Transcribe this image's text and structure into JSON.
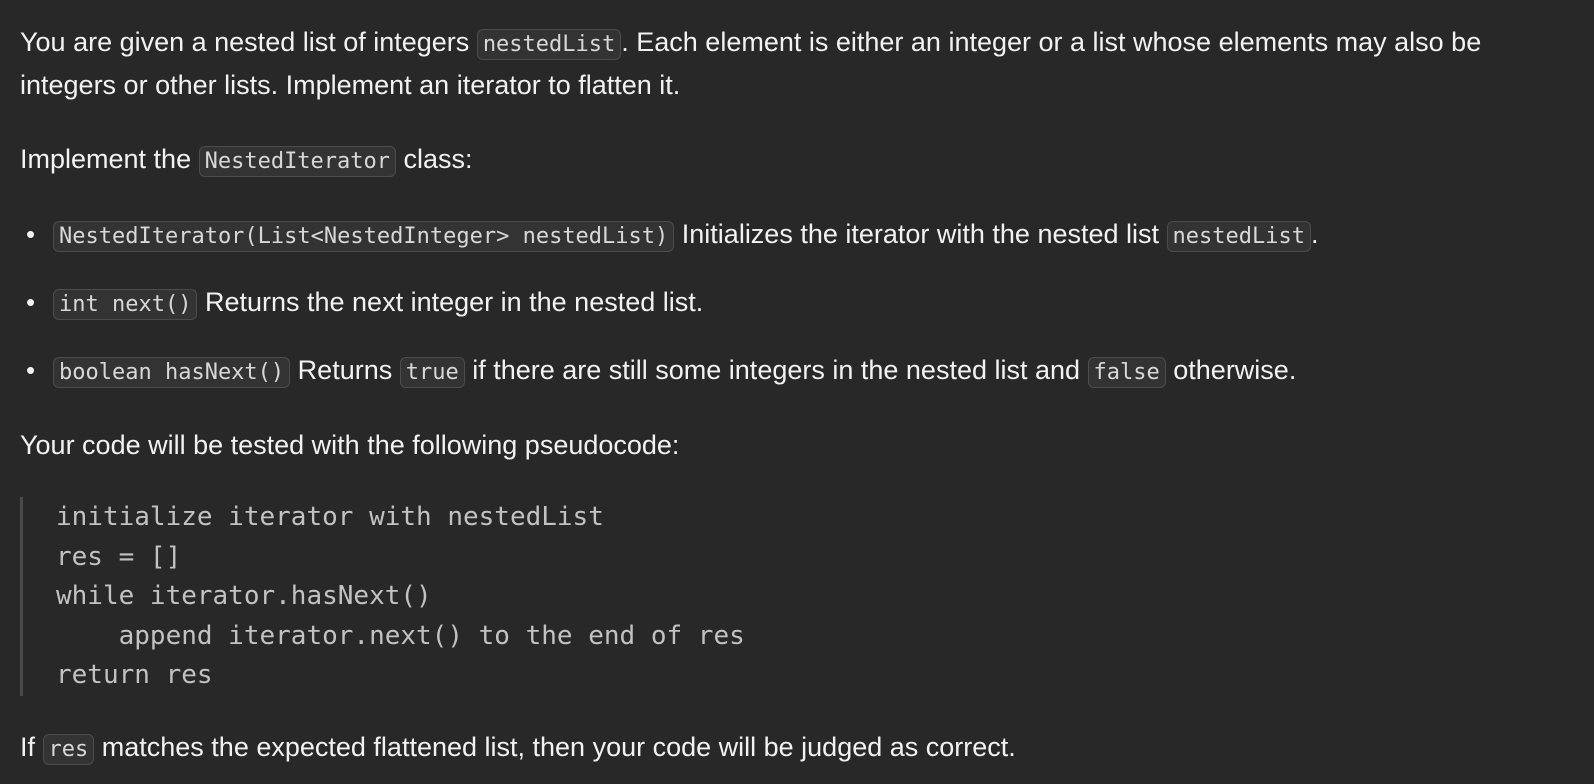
{
  "intro": {
    "part1": "You are given a nested list of integers ",
    "code1": "nestedList",
    "part2": ". Each element is either an integer or a list whose elements may also be integers or other lists. Implement an iterator to flatten it."
  },
  "implement": {
    "part1": "Implement the ",
    "code1": "NestedIterator",
    "part2": " class:"
  },
  "methods": [
    {
      "signature": "NestedIterator(List<NestedInteger> nestedList)",
      "text1": " Initializes the iterator with the nested list ",
      "code2": "nestedList",
      "text2": "."
    },
    {
      "signature": "int next()",
      "text1": " Returns the next integer in the nested list."
    },
    {
      "signature": "boolean hasNext()",
      "text1": " Returns ",
      "code2": "true",
      "text2": " if there are still some integers in the nested list and ",
      "code3": "false",
      "text3": " otherwise."
    }
  ],
  "test_intro": "Your code will be tested with the following pseudocode:",
  "pseudocode": [
    "initialize iterator with nestedList",
    "res = []",
    "while iterator.hasNext()",
    "    append iterator.next() to the end of res",
    "return res"
  ],
  "conclusion": {
    "part1": "If ",
    "code1": "res",
    "part2": " matches the expected flattened list, then your code will be judged as correct."
  }
}
